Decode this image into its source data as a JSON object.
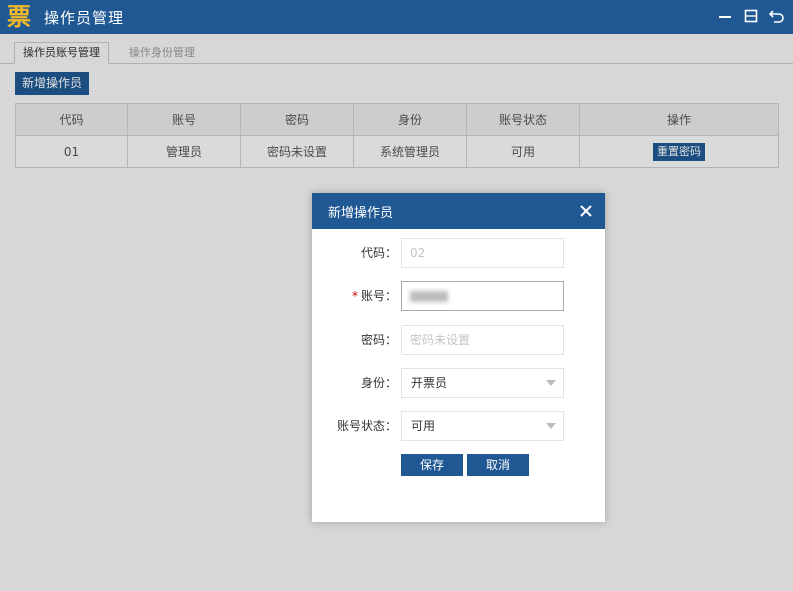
{
  "window": {
    "logo_char": "票",
    "title": "操作员管理"
  },
  "tabs": [
    {
      "label": "操作员账号管理"
    },
    {
      "label": "操作身份管理"
    }
  ],
  "toolbar": {
    "add_label": "新增操作员"
  },
  "table": {
    "headers": [
      "代码",
      "账号",
      "密码",
      "身份",
      "账号状态",
      "操作"
    ],
    "rows": [
      {
        "code": "01",
        "account": "管理员",
        "password": "密码未设置",
        "role": "系统管理员",
        "status": "可用",
        "action": "重置密码"
      }
    ]
  },
  "dialog": {
    "title": "新增操作员",
    "fields": {
      "code": {
        "label": "代码：",
        "placeholder": "02"
      },
      "account": {
        "required_mark": "*",
        "label": "账号："
      },
      "password": {
        "label": "密码：",
        "placeholder": "密码未设置"
      },
      "role": {
        "label": "身份：",
        "value": "开票员"
      },
      "status": {
        "label": "账号状态：",
        "value": "可用"
      }
    },
    "save_label": "保存",
    "cancel_label": "取消"
  },
  "colors": {
    "brand": "#1f5893",
    "logo": "#f2b82c"
  }
}
